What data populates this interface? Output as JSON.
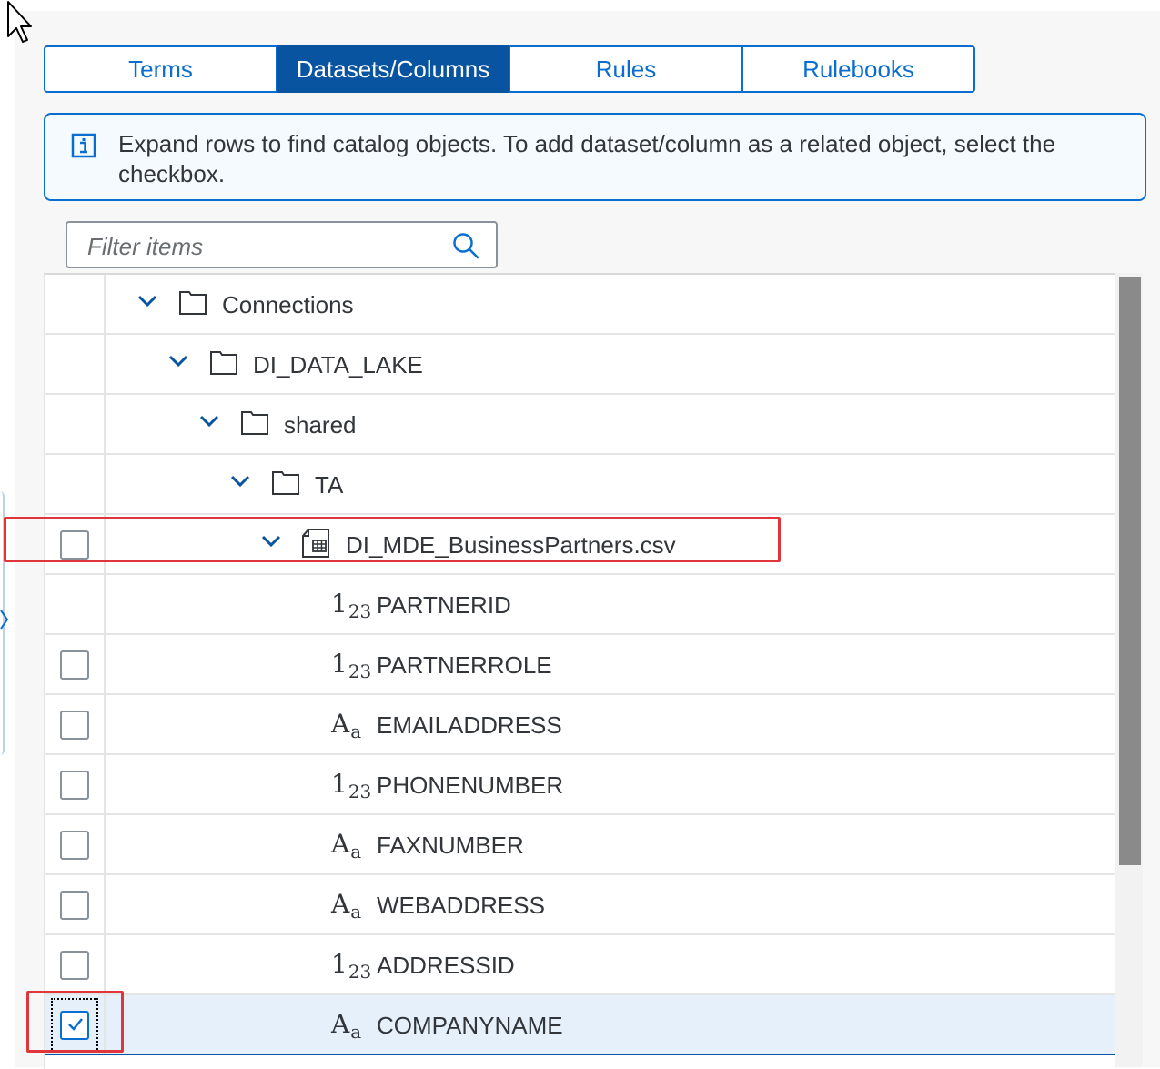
{
  "tabs": [
    {
      "label": "Terms",
      "active": false
    },
    {
      "label": "Datasets/Columns",
      "active": true
    },
    {
      "label": "Rules",
      "active": false
    },
    {
      "label": "Rulebooks",
      "active": false
    }
  ],
  "info": {
    "text": "Expand rows to find catalog objects. To add dataset/column as a related object, select the checkbox.",
    "icon": "info-icon"
  },
  "search": {
    "placeholder": "Filter items",
    "value": "",
    "icon": "search-icon"
  },
  "tree": [
    {
      "label": "Connections",
      "icon": "folder-icon",
      "expanded": true,
      "checkbox": false
    },
    {
      "label": "DI_DATA_LAKE",
      "icon": "folder-icon",
      "expanded": true,
      "checkbox": false
    },
    {
      "label": "shared",
      "icon": "folder-icon",
      "expanded": true,
      "checkbox": false
    },
    {
      "label": "TA",
      "icon": "folder-icon",
      "expanded": true,
      "checkbox": false
    },
    {
      "label": "DI_MDE_BusinessPartners.csv",
      "icon": "dataset-file-icon",
      "expanded": true,
      "checkbox": true,
      "checked": false
    },
    {
      "label": "PARTNERID",
      "type_icon": "1₂₃",
      "type": "numeric",
      "checkbox": false
    },
    {
      "label": "PARTNERROLE",
      "type_icon": "1₂₃",
      "type": "numeric",
      "checkbox": true,
      "checked": false
    },
    {
      "label": "EMAILADDRESS",
      "type_icon": "Aₐ",
      "type": "string",
      "checkbox": true,
      "checked": false
    },
    {
      "label": "PHONENUMBER",
      "type_icon": "1₂₃",
      "type": "numeric",
      "checkbox": true,
      "checked": false
    },
    {
      "label": "FAXNUMBER",
      "type_icon": "Aₐ",
      "type": "string",
      "checkbox": true,
      "checked": false
    },
    {
      "label": "WEBADDRESS",
      "type_icon": "Aₐ",
      "type": "string",
      "checkbox": true,
      "checked": false
    },
    {
      "label": "ADDRESSID",
      "type_icon": "1₂₃",
      "type": "numeric",
      "checkbox": true,
      "checked": false
    },
    {
      "label": "COMPANYNAME",
      "type_icon": "Aₐ",
      "type": "string",
      "checkbox": true,
      "checked": true,
      "selected": true
    }
  ],
  "colors": {
    "accent": "#0a6ed1",
    "active_tab": "#0854a0",
    "highlight_box": "#e0353a",
    "selected_row": "#e5f0fa"
  }
}
